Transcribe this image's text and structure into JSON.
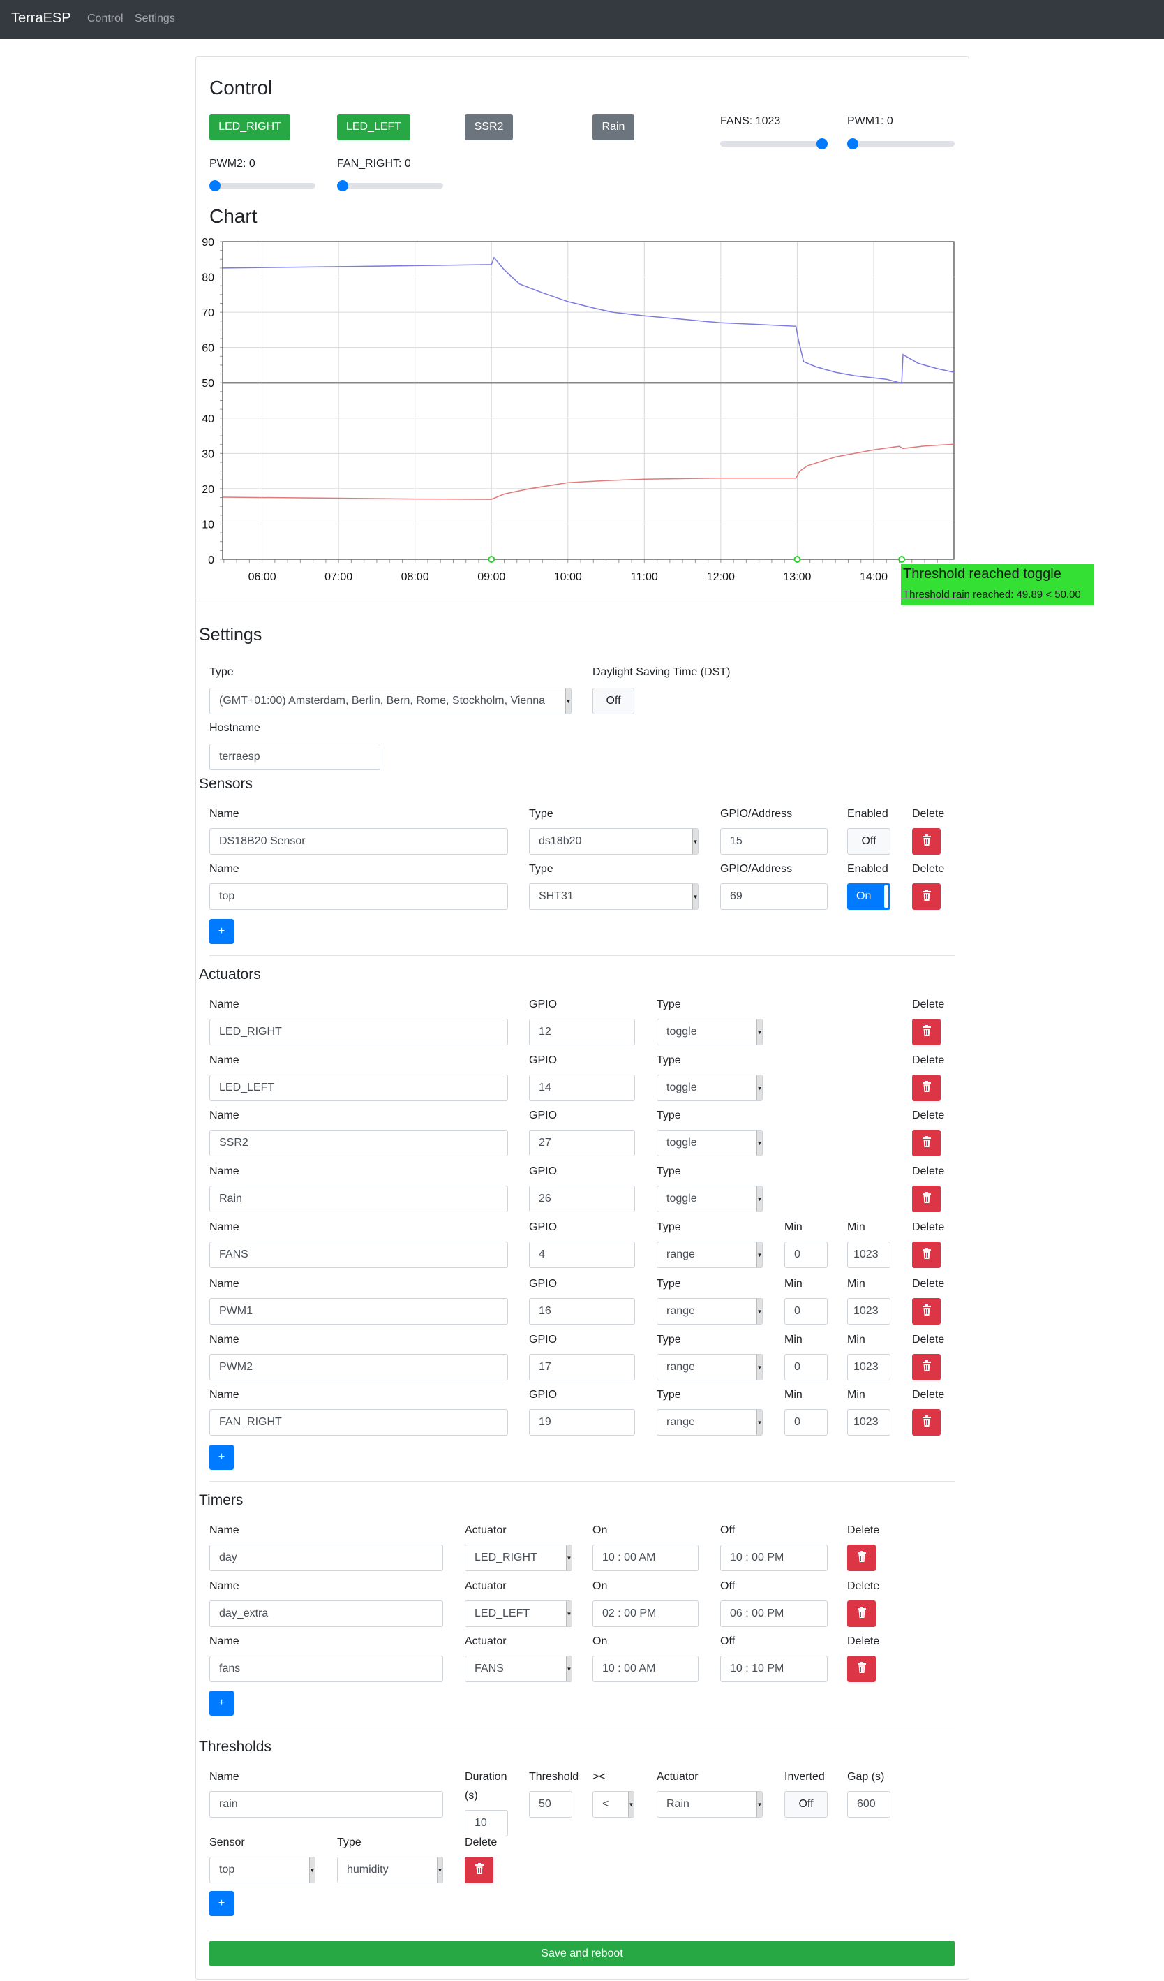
{
  "nav": {
    "brand": "TerraESP",
    "links": [
      "Control",
      "Settings"
    ]
  },
  "control": {
    "title": "Control",
    "toggles": [
      {
        "label": "LED_RIGHT",
        "state": "on",
        "color": "#28a745"
      },
      {
        "label": "LED_LEFT",
        "state": "on",
        "color": "#28a745"
      },
      {
        "label": "SSR2",
        "state": "off",
        "color": "#6c757d"
      },
      {
        "label": "Rain",
        "state": "off",
        "color": "#6c757d"
      }
    ],
    "sliders": [
      {
        "label": "FANS: 1023",
        "value": 1023,
        "max": 1023
      },
      {
        "label": "PWM1: 0",
        "value": 0,
        "max": 1023
      },
      {
        "label": "PWM2: 0",
        "value": 0,
        "max": 1023
      },
      {
        "label": "FAN_RIGHT: 0",
        "value": 0,
        "max": 1023
      }
    ]
  },
  "chart_title": "Chart",
  "chart_data": {
    "type": "line",
    "xlim": [
      "05:29",
      "15:03"
    ],
    "ylim": [
      0,
      90
    ],
    "x_ticks": [
      "06:00",
      "07:00",
      "08:00",
      "09:00",
      "10:00",
      "11:00",
      "12:00",
      "13:00",
      "14:00"
    ],
    "y_ticks": [
      "0",
      "10",
      "20",
      "30",
      "40",
      "50",
      "60",
      "70",
      "80",
      "90"
    ],
    "grid": true,
    "threshold_line": 50,
    "series": [
      {
        "color": "#7b7be0",
        "points": [
          [
            "05:29",
            82.5
          ],
          [
            "07:00",
            82.9
          ],
          [
            "08:00",
            83.2
          ],
          [
            "09:00",
            83.5
          ],
          [
            "09:02",
            85.5
          ],
          [
            "09:10",
            82
          ],
          [
            "09:22",
            78
          ],
          [
            "09:40",
            75.5
          ],
          [
            "10:00",
            73
          ],
          [
            "10:20",
            71.2
          ],
          [
            "10:35",
            70
          ],
          [
            "11:00",
            69
          ],
          [
            "11:30",
            68
          ],
          [
            "12:00",
            67
          ],
          [
            "12:30",
            66.5
          ],
          [
            "12:59",
            66
          ],
          [
            "13:01",
            62
          ],
          [
            "13:05",
            56
          ],
          [
            "13:15",
            54.5
          ],
          [
            "13:30",
            53
          ],
          [
            "13:45",
            52
          ],
          [
            "14:10",
            51
          ],
          [
            "14:22",
            49.89
          ],
          [
            "14:23",
            58
          ],
          [
            "14:35",
            55.5
          ],
          [
            "14:50",
            54
          ],
          [
            "15:03",
            53
          ]
        ]
      },
      {
        "color": "#e07b7b",
        "points": [
          [
            "05:29",
            17.6
          ],
          [
            "07:00",
            17.3
          ],
          [
            "08:00",
            17.1
          ],
          [
            "09:00",
            17
          ],
          [
            "09:10",
            18.5
          ],
          [
            "09:30",
            20
          ],
          [
            "10:00",
            21.7
          ],
          [
            "10:30",
            22.3
          ],
          [
            "11:00",
            22.7
          ],
          [
            "12:00",
            23
          ],
          [
            "12:59",
            23
          ],
          [
            "13:02",
            25
          ],
          [
            "13:08",
            26.5
          ],
          [
            "13:30",
            29
          ],
          [
            "14:00",
            31
          ],
          [
            "14:20",
            32
          ],
          [
            "14:23",
            31.4
          ],
          [
            "14:40",
            32.1
          ],
          [
            "15:03",
            32.6
          ]
        ]
      }
    ],
    "markers": [
      {
        "x": "09:00",
        "y": 0,
        "color": "#33cc33"
      },
      {
        "x": "13:00",
        "y": 0,
        "color": "#33cc33"
      },
      {
        "x": "14:22",
        "y": 0,
        "color": "#33cc33"
      }
    ],
    "tooltip": {
      "title": "Threshold reached toggle",
      "text": "Threshold rain reached: 49.89 < 50.00",
      "color": "#33e033"
    }
  },
  "settings": {
    "title": "Settings",
    "timezone_label": "Type",
    "timezone_value": "(GMT+01:00) Amsterdam, Berlin, Bern, Rome, Stockholm, Vienna",
    "dst_label": "Daylight Saving Time (DST)",
    "dst_value": "Off",
    "hostname_label": "Hostname",
    "hostname_value": "terraesp",
    "save_label": "Save and reboot",
    "add_label": "+"
  },
  "sensors": {
    "title": "Sensors",
    "headers": [
      "Name",
      "Type",
      "GPIO/Address",
      "Enabled",
      "Delete"
    ],
    "rows": [
      {
        "name": "DS18B20 Sensor",
        "type": "ds18b20",
        "gpio": "15",
        "enabled": "Off"
      },
      {
        "name": "top",
        "type": "SHT31",
        "gpio": "69",
        "enabled": "On"
      }
    ]
  },
  "actuators": {
    "title": "Actuators",
    "headers": [
      "Name",
      "GPIO",
      "Type",
      "Min",
      "Min",
      "Delete"
    ],
    "rows": [
      {
        "name": "LED_RIGHT",
        "gpio": "12",
        "type": "toggle"
      },
      {
        "name": "LED_LEFT",
        "gpio": "14",
        "type": "toggle"
      },
      {
        "name": "SSR2",
        "gpio": "27",
        "type": "toggle"
      },
      {
        "name": "Rain",
        "gpio": "26",
        "type": "toggle"
      },
      {
        "name": "FANS",
        "gpio": "4",
        "type": "range",
        "min": "0",
        "max": "1023"
      },
      {
        "name": "PWM1",
        "gpio": "16",
        "type": "range",
        "min": "0",
        "max": "1023"
      },
      {
        "name": "PWM2",
        "gpio": "17",
        "type": "range",
        "min": "0",
        "max": "1023"
      },
      {
        "name": "FAN_RIGHT",
        "gpio": "19",
        "type": "range",
        "min": "0",
        "max": "1023"
      }
    ]
  },
  "timers": {
    "title": "Timers",
    "headers": [
      "Name",
      "Actuator",
      "On",
      "Off",
      "Delete"
    ],
    "rows": [
      {
        "name": "day",
        "actuator": "LED_RIGHT",
        "on": "10 : 00  AM",
        "off": "10 : 00  PM"
      },
      {
        "name": "day_extra",
        "actuator": "LED_LEFT",
        "on": "02 : 00  PM",
        "off": "06 : 00  PM"
      },
      {
        "name": "fans",
        "actuator": "FANS",
        "on": "10 : 00  AM",
        "off": "10 : 10  PM"
      }
    ]
  },
  "thresholds": {
    "title": "Thresholds",
    "headers": [
      "Name",
      "Duration",
      "(s)",
      "Threshold",
      "><",
      "Actuator",
      "Inverted",
      "Gap (s)",
      "Sensor",
      "Type",
      "Delete"
    ],
    "rows": [
      {
        "name": "rain",
        "duration": "10",
        "threshold": "50",
        "comparator": "<",
        "actuator": "Rain",
        "inverted": "Off",
        "gap": "600",
        "sensor": "top",
        "type": "humidity"
      }
    ]
  }
}
